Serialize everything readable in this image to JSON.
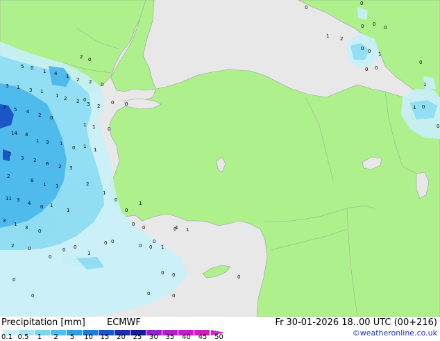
{
  "footer": {
    "title": "Precipitation [mm]",
    "model": "ECMWF",
    "valid_time": "Fr 30-01-2026 18..00 UTC (00+216)",
    "copyright": "©weatheronline.co.uk"
  },
  "legend": {
    "labels": [
      "0.1",
      "0.5",
      "1",
      "2",
      "5",
      "10",
      "15",
      "20",
      "25",
      "30",
      "35",
      "40",
      "45",
      "50"
    ],
    "colors": [
      "#c8f0f8",
      "#a4e6f6",
      "#78d6f2",
      "#4cc0ec",
      "#2aa2e2",
      "#1e7ed6",
      "#1a56c8",
      "#1830b0",
      "#141c98",
      "#9820cc",
      "#b41ccc",
      "#c81ac8",
      "#d81ab8"
    ]
  },
  "map": {
    "colors": {
      "sea": "#e8e8e8",
      "land": "#aef08c",
      "precip_light": "#c8f0f8",
      "precip_med": "#8edcf4",
      "precip_heavy": "#4cb8ec",
      "precip_max": "#1a56c8"
    },
    "values": [
      {
        "text": "0"
      },
      {
        "text": "0"
      },
      {
        "text": "0"
      },
      {
        "text": "0"
      },
      {
        "text": "0"
      },
      {
        "text": "0"
      },
      {
        "text": "2"
      },
      {
        "text": "0"
      },
      {
        "text": "5"
      },
      {
        "text": "0"
      },
      {
        "text": "1"
      },
      {
        "text": "4"
      },
      {
        "text": "1"
      },
      {
        "text": "2"
      },
      {
        "text": "2"
      },
      {
        "text": "0"
      },
      {
        "text": "3"
      },
      {
        "text": "1"
      },
      {
        "text": "3"
      },
      {
        "text": "1"
      },
      {
        "text": "1"
      },
      {
        "text": "2"
      },
      {
        "text": "2"
      },
      {
        "text": "0"
      },
      {
        "text": "3"
      },
      {
        "text": "2"
      },
      {
        "text": "0"
      },
      {
        "text": "0"
      },
      {
        "text": "7"
      },
      {
        "text": "5"
      },
      {
        "text": "4"
      },
      {
        "text": "2"
      },
      {
        "text": "0"
      },
      {
        "text": "1"
      },
      {
        "text": "1"
      },
      {
        "text": "0"
      },
      {
        "text": "14"
      },
      {
        "text": "4"
      },
      {
        "text": "1"
      },
      {
        "text": "3"
      },
      {
        "text": "1"
      },
      {
        "text": "0"
      },
      {
        "text": "1"
      },
      {
        "text": "1"
      },
      {
        "text": "3"
      },
      {
        "text": "3"
      },
      {
        "text": "2"
      },
      {
        "text": "6"
      },
      {
        "text": "2"
      },
      {
        "text": "3"
      },
      {
        "text": "2"
      },
      {
        "text": "8"
      },
      {
        "text": "1"
      },
      {
        "text": "1"
      },
      {
        "text": "2"
      },
      {
        "text": "11"
      },
      {
        "text": "3"
      },
      {
        "text": "4"
      },
      {
        "text": "0"
      },
      {
        "text": "1"
      },
      {
        "text": "1"
      },
      {
        "text": "3"
      },
      {
        "text": "1"
      },
      {
        "text": "3"
      },
      {
        "text": "0"
      },
      {
        "text": "1"
      },
      {
        "text": "0"
      },
      {
        "text": "0"
      },
      {
        "text": "1"
      },
      {
        "text": "0"
      },
      {
        "text": "0"
      },
      {
        "text": "0"
      },
      {
        "text": "1"
      },
      {
        "text": "0"
      },
      {
        "text": "4"
      },
      {
        "text": "1"
      },
      {
        "text": "2"
      },
      {
        "text": "0"
      },
      {
        "text": "0"
      },
      {
        "text": "0"
      },
      {
        "text": "0"
      },
      {
        "text": "1"
      },
      {
        "text": "0"
      },
      {
        "text": "0"
      },
      {
        "text": "0"
      },
      {
        "text": "0"
      },
      {
        "text": "0"
      },
      {
        "text": "0"
      },
      {
        "text": "0"
      },
      {
        "text": "0"
      },
      {
        "text": "0"
      },
      {
        "text": "0"
      },
      {
        "text": "0"
      },
      {
        "text": "0"
      },
      {
        "text": "1"
      },
      {
        "text": "0"
      },
      {
        "text": "1"
      },
      {
        "text": "0"
      },
      {
        "text": "0"
      },
      {
        "text": "0"
      },
      {
        "text": "1"
      },
      {
        "text": "2"
      },
      {
        "text": "0"
      },
      {
        "text": "1"
      }
    ]
  }
}
